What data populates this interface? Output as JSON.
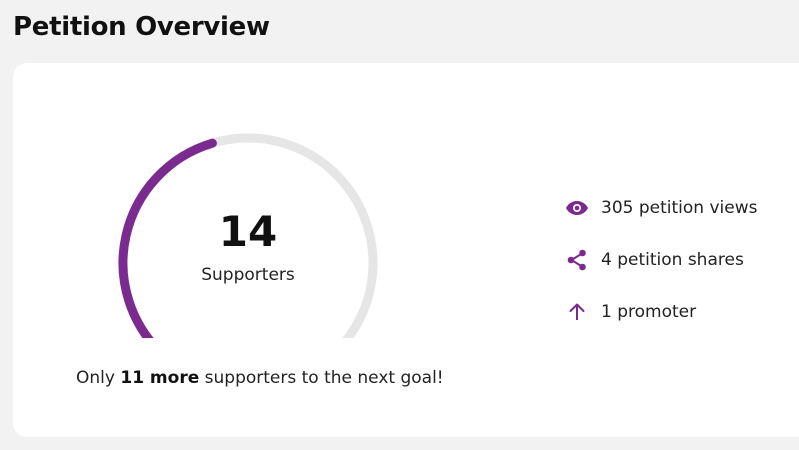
{
  "page": {
    "title": "Petition Overview"
  },
  "gauge": {
    "count": "14",
    "label": "Supporters",
    "progress_fraction": 0.44,
    "accent_color": "#7b2a8f",
    "track_color": "#e6e6e6"
  },
  "goal_message": {
    "prefix": "Only",
    "highlight": "11 more",
    "suffix": "supporters to the next goal!"
  },
  "stats": [
    {
      "icon": "eye-icon",
      "text": "305 petition views"
    },
    {
      "icon": "share-icon",
      "text": "4 petition shares"
    },
    {
      "icon": "arrow-up-icon",
      "text": "1 promoter"
    }
  ]
}
